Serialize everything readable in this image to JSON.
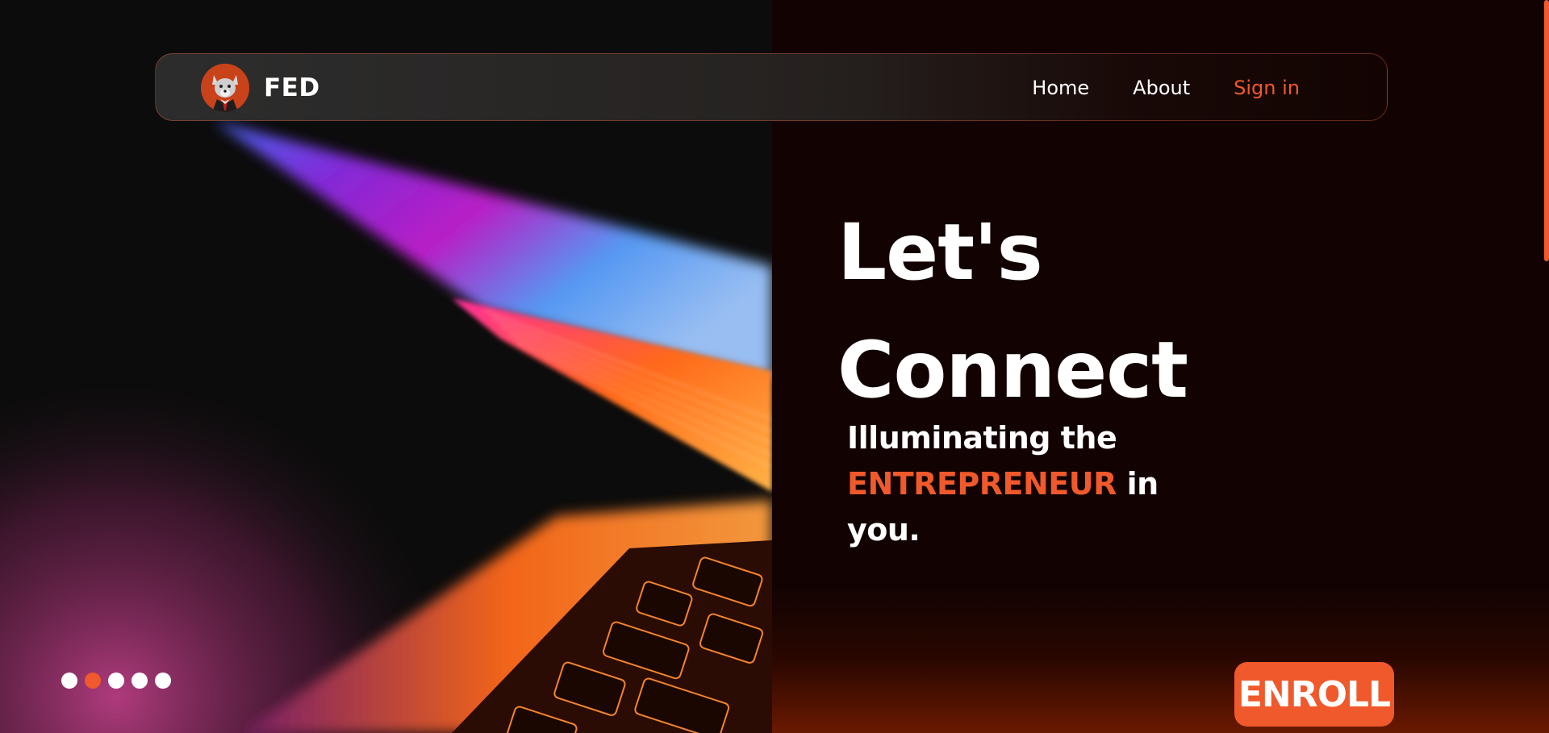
{
  "brand": {
    "name": "FED",
    "logo_icon": "wolf-avatar-icon"
  },
  "nav": {
    "items": [
      {
        "label": "Home"
      },
      {
        "label": "About"
      },
      {
        "label": "Sign in"
      }
    ]
  },
  "hero": {
    "headline_line1": "Let's",
    "headline_line2": "Connect",
    "tagline_pre": "Illuminating the",
    "tagline_highlight": "ENTREPRENEUR",
    "tagline_mid": " in",
    "tagline_post": "you.",
    "cta_label": "ENROLL",
    "image_icon": "laptop-keyboard-photo"
  },
  "carousel": {
    "count": 5,
    "active_index": 1
  },
  "colors": {
    "accent": "#f0592b",
    "background": "#120302",
    "text": "#ffffff"
  }
}
